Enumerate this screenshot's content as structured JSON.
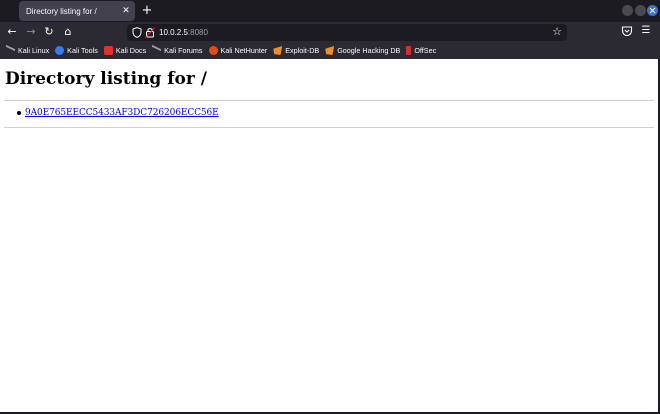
{
  "browser": {
    "tab": {
      "title": "Directory listing for /",
      "close_glyph": "✕"
    },
    "new_tab_glyph": "+",
    "window_controls": [
      "minimize",
      "maximize",
      "close"
    ],
    "nav": {
      "back_glyph": "←",
      "forward_glyph": "→",
      "reload_glyph": "↻",
      "home_glyph": "⌂"
    },
    "url": {
      "host": "10.0.2.5",
      "port": ":8080"
    },
    "icons": {
      "shield": "shield-icon",
      "lock": "insecure-lock-icon",
      "star": "bookmark-star-icon",
      "pocket": "pocket-icon",
      "menu": "hamburger-menu-icon"
    },
    "bookmarks": [
      {
        "label": "Kali Linux",
        "icon": "kali-dragon-icon"
      },
      {
        "label": "Kali Tools",
        "icon": "kali-tools-icon"
      },
      {
        "label": "Kali Docs",
        "icon": "kali-docs-icon"
      },
      {
        "label": "Kali Forums",
        "icon": "kali-dragon-icon"
      },
      {
        "label": "Kali NetHunter",
        "icon": "nethunter-icon"
      },
      {
        "label": "Exploit-DB",
        "icon": "exploit-db-icon"
      },
      {
        "label": "Google Hacking DB",
        "icon": "exploit-db-icon"
      },
      {
        "label": "OffSec",
        "icon": "offsec-icon"
      }
    ],
    "colors": {
      "chrome_dark": "#1c1b22",
      "toolbar": "#2b2a33",
      "tab_active": "#42414d",
      "accent_close": "#3b6ee0",
      "link": "#0000ee"
    }
  },
  "page": {
    "title": "Directory listing for /",
    "entries": [
      {
        "name": "9A0E765EECC5433AF3DC726206ECC56E"
      }
    ]
  }
}
